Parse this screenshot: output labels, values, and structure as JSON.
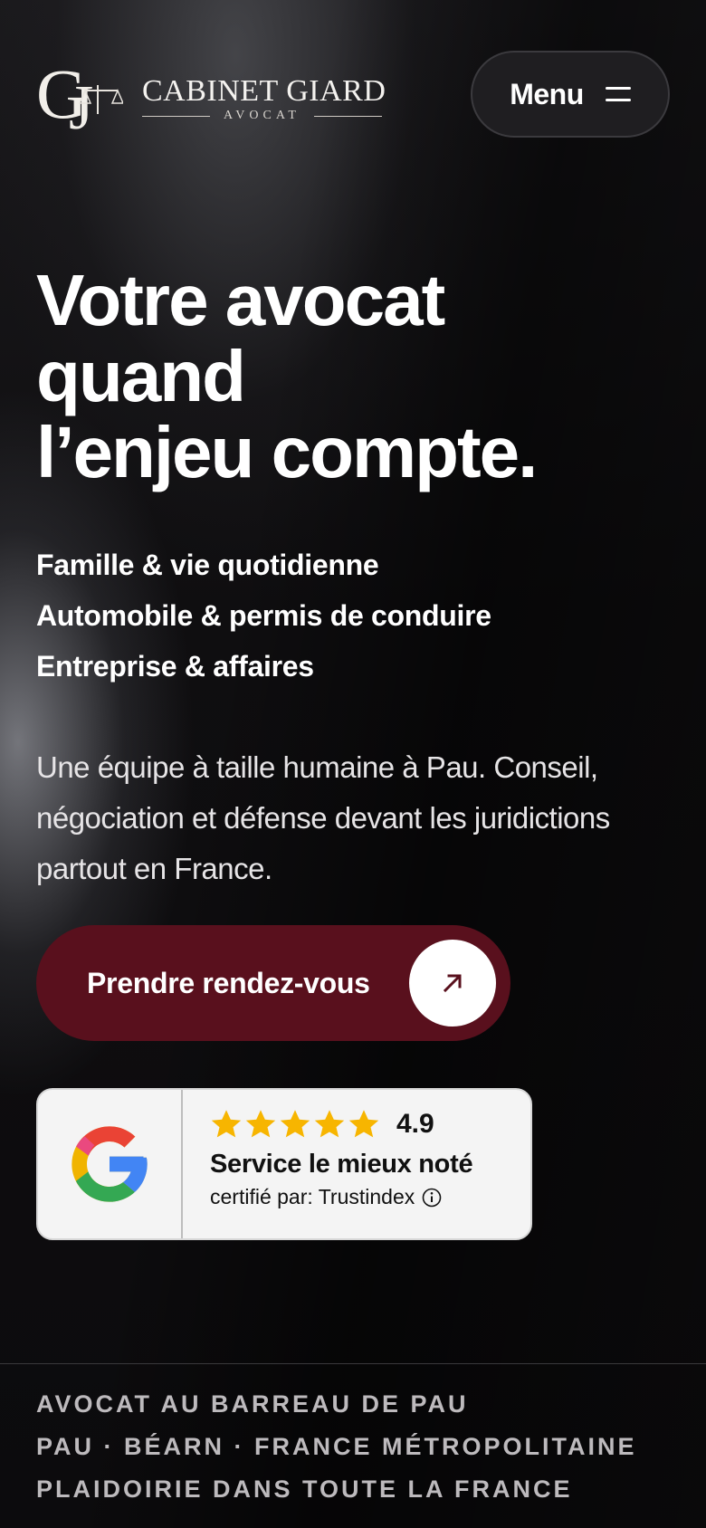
{
  "header": {
    "logo_name": "CABINET GIARD",
    "logo_sub": "AVOCAT",
    "logo_monogram": "GJ",
    "menu_label": "Menu",
    "menu_icon": "hamburger-icon"
  },
  "hero": {
    "title_lines": [
      "Votre avocat",
      "quand",
      "l’enjeu compte."
    ],
    "practice_areas": [
      "Famille & vie quotidienne",
      "Automobile & permis de conduire",
      "Entreprise & affaires"
    ],
    "intro": "Une équipe à taille humaine à Pau. Conseil, négociation et défense devant les juridictions partout en France."
  },
  "cta": {
    "label": "Prendre rendez-vous",
    "icon": "arrow-up-right-icon",
    "color": "#59101d"
  },
  "review": {
    "provider_icon": "google-g-icon",
    "stars": 5,
    "rating": "4.9",
    "title": "Service le mieux noté",
    "certified": "certifié par: Trustindex",
    "info_icon": "info-icon",
    "star_color": "#f7b500"
  },
  "footer": {
    "lines": [
      "AVOCAT AU BARREAU DE PAU",
      "PAU · BÉARN · FRANCE MÉTROPOLITAINE",
      "PLAIDOIRIE DANS TOUTE LA FRANCE"
    ]
  }
}
